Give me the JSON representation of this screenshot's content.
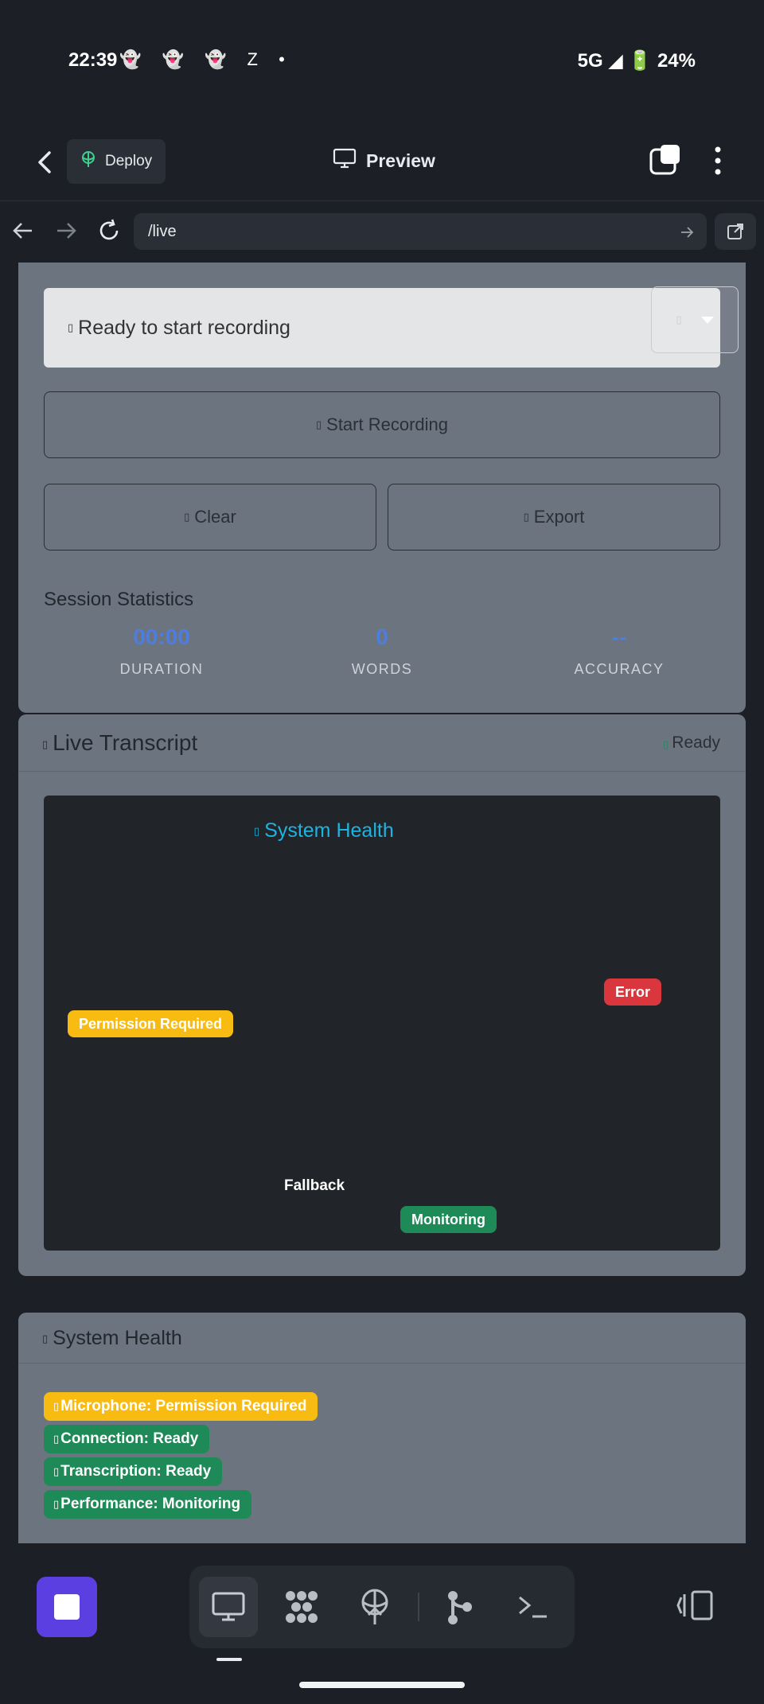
{
  "status_bar": {
    "time": "22:39",
    "notification_icons": "👻 👻 👻 Z •",
    "right": "5G ◢ 🔋 24%"
  },
  "app_bar": {
    "deploy_label": "Deploy",
    "title": "Preview"
  },
  "browser": {
    "url": "/live"
  },
  "recorder": {
    "status_icon_glyph": "▯",
    "status_text": "Ready to start recording",
    "select_glyph": "▯",
    "start_label": "Start Recording",
    "clear_label": "Clear",
    "export_label": "Export"
  },
  "stats": {
    "title": "Session Statistics",
    "items": [
      {
        "value": "00:00",
        "label": "DURATION"
      },
      {
        "value": "0",
        "label": "WORDS"
      },
      {
        "value": "--",
        "label": "ACCURACY"
      }
    ]
  },
  "transcript": {
    "title": "Live Transcript",
    "status": "Ready",
    "panel_title": "System Health",
    "badges": {
      "permission": "Permission Required",
      "error": "Error",
      "fallback": "Fallback",
      "monitoring": "Monitoring"
    }
  },
  "system_health": {
    "title": "System Health",
    "items": [
      {
        "label": "Microphone: Permission Required",
        "color": "#f7bb12"
      },
      {
        "label": "Connection: Ready",
        "color": "#1e8a57"
      },
      {
        "label": "Transcription: Ready",
        "color": "#1e8a57"
      },
      {
        "label": "Performance: Monitoring",
        "color": "#1e8a57"
      }
    ]
  },
  "colors": {
    "accent_purple": "#5b3fe0",
    "stat_blue": "#4d7de0",
    "health_title_cyan": "#1fb3e0"
  }
}
